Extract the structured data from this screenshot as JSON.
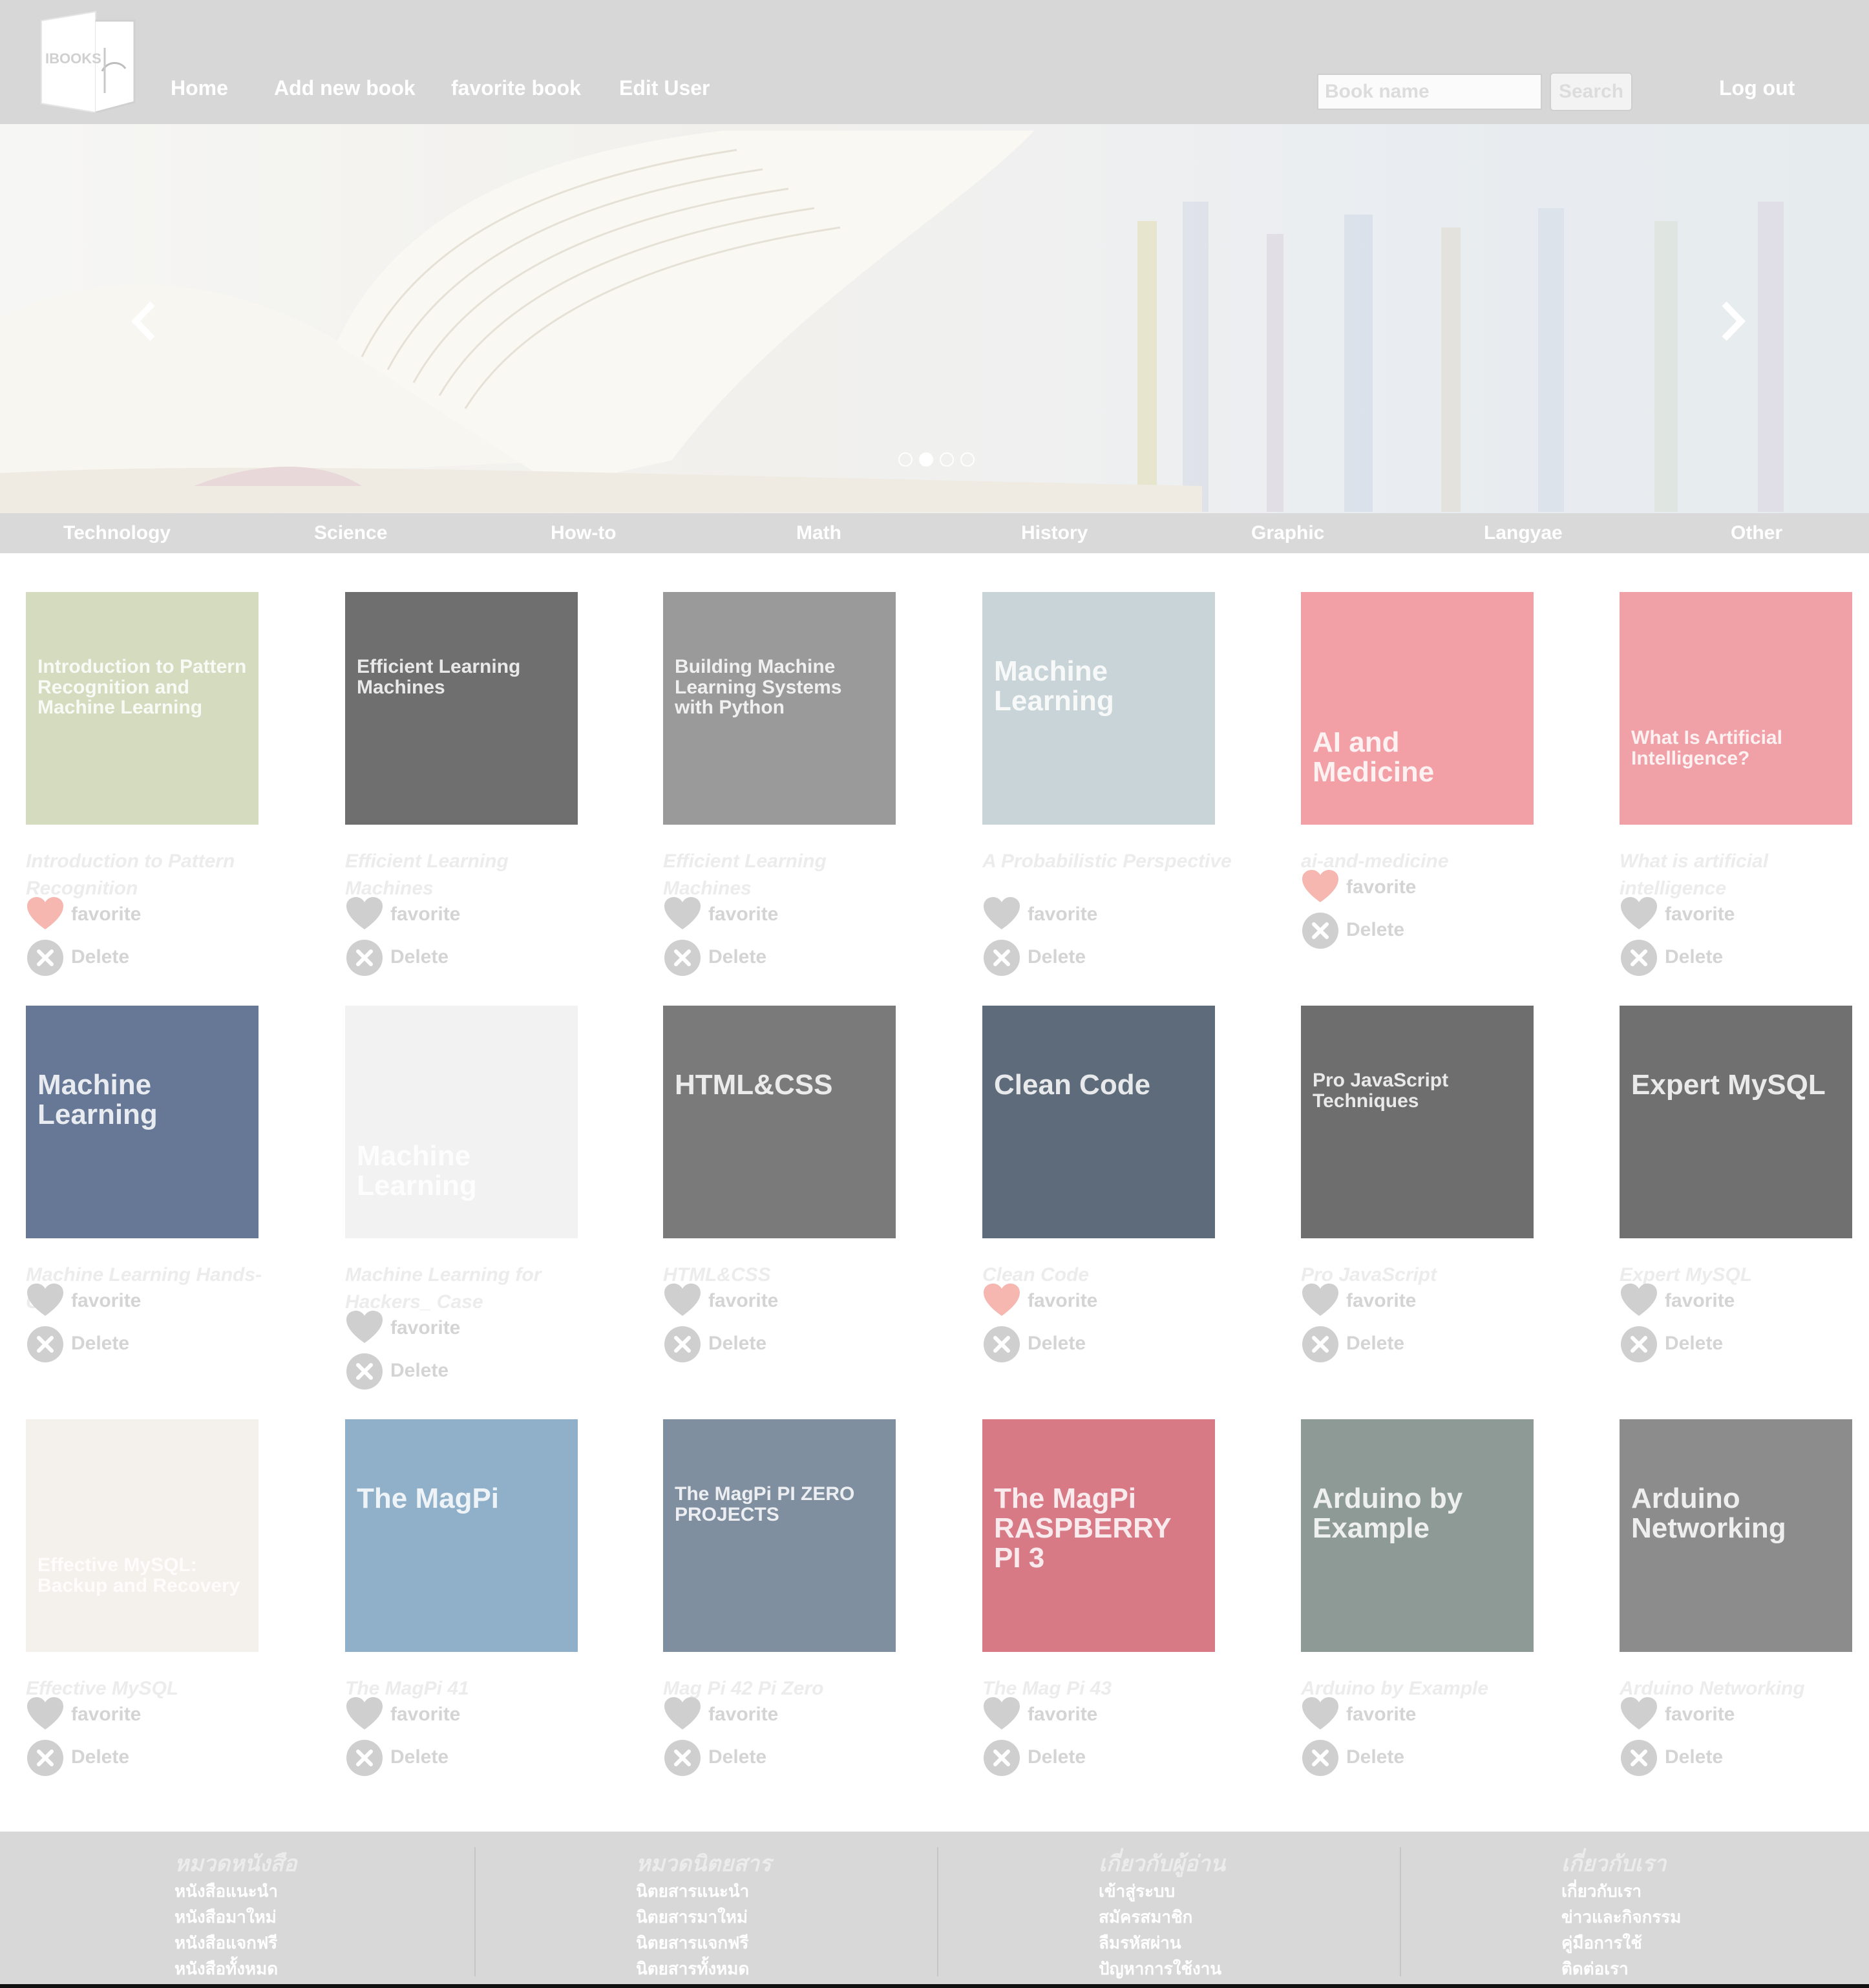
{
  "app": {
    "logo_text": "IBOOKS"
  },
  "nav": {
    "home": "Home",
    "add_new_book": "Add new book",
    "favorite_book": "favorite book",
    "edit_user": "Edit User",
    "logout": "Log out"
  },
  "search": {
    "placeholder": "Book name",
    "button": "Search"
  },
  "carousel": {
    "slide_count": 4,
    "active_index": 1
  },
  "categories": [
    "Technology",
    "Science",
    "How-to",
    "Math",
    "History",
    "Graphic",
    "Langyae",
    "Other"
  ],
  "actions": {
    "favorite": "favorite",
    "delete": "Delete"
  },
  "colors": {
    "header_bg": "#d7d7d7",
    "favorite_active": "#f5b7b0",
    "favorite_inactive": "#cfcfcf",
    "delete_icon": "#cfcfcf"
  },
  "books": [
    {
      "title": "Introduction to Pattern Recognition",
      "favorited": true,
      "cover_color": "#d4dbbf",
      "cover_text": "Introduction to Pattern Recognition and Machine Learning"
    },
    {
      "title": "Efficient Learning Machines",
      "favorited": false,
      "cover_color": "#6f6f6f",
      "cover_text": "Efficient Learning Machines"
    },
    {
      "title": "Efficient Learning Machines",
      "favorited": false,
      "cover_color": "#9a9a9a",
      "cover_text": "Building Machine Learning Systems with Python"
    },
    {
      "title": "A Probabilistic Perspective",
      "favorited": false,
      "cover_color": "#c8d4d8",
      "cover_text": "Machine Learning"
    },
    {
      "title": "ai-and-medicine",
      "favorited": true,
      "cover_color": "#f2a0a6",
      "cover_text": "AI and Medicine"
    },
    {
      "title": "What is artificial intelligence",
      "favorited": false,
      "cover_color": "#f0a1a8",
      "cover_text": "What Is Artificial Intelligence?"
    },
    {
      "title": "Machine Learning Hands-On",
      "favorited": false,
      "cover_color": "#667896",
      "cover_text": "Machine Learning"
    },
    {
      "title": "Machine Learning for Hackers_ Case",
      "favorited": false,
      "cover_color": "#f2f2f2",
      "cover_text": "Machine Learning"
    },
    {
      "title": "HTML&CSS",
      "favorited": false,
      "cover_color": "#7a7a7a",
      "cover_text": "HTML&CSS"
    },
    {
      "title": "Clean Code",
      "favorited": true,
      "cover_color": "#5d6b7a",
      "cover_text": "Clean Code"
    },
    {
      "title": "Pro JavaScript",
      "favorited": false,
      "cover_color": "#6e6e6e",
      "cover_text": "Pro JavaScript Techniques"
    },
    {
      "title": "Expert MySQL",
      "favorited": false,
      "cover_color": "#707070",
      "cover_text": "Expert MySQL"
    },
    {
      "title": "Effective MySQL",
      "favorited": false,
      "cover_color": "#f4f0ec",
      "cover_text": "Effective MySQL: Backup and Recovery"
    },
    {
      "title": "The MagPi 41",
      "favorited": false,
      "cover_color": "#8fb0c8",
      "cover_text": "The MagPi"
    },
    {
      "title": "Mag Pi 42 Pi Zero",
      "favorited": false,
      "cover_color": "#7f8fa0",
      "cover_text": "The MagPi PI ZERO PROJECTS"
    },
    {
      "title": "The Mag Pi 43",
      "favorited": false,
      "cover_color": "#d87a86",
      "cover_text": "The MagPi RASPBERRY PI 3"
    },
    {
      "title": "Arduino by Example",
      "favorited": false,
      "cover_color": "#8e9a96",
      "cover_text": "Arduino by Example"
    },
    {
      "title": "Arduino Networking",
      "favorited": false,
      "cover_color": "#8c8c8c",
      "cover_text": "Arduino Networking"
    }
  ],
  "footer": [
    {
      "heading": "หมวดหนังสือ",
      "links": [
        "หนังสือแนะนำ",
        "หนังสือมาใหม่",
        "หนังสือแจกฟรี",
        "หนังสือทั้งหมด"
      ]
    },
    {
      "heading": "หมวดนิตยสาร",
      "links": [
        "นิตยสารแนะนำ",
        "นิตยสารมาใหม่",
        "นิตยสารแจกฟรี",
        "นิตยสารทั้งหมด"
      ]
    },
    {
      "heading": "เกี่ยวกับผู้อ่าน",
      "links": [
        "เข้าสู่ระบบ",
        "สมัครสมาชิก",
        "ลืมรหัสผ่าน",
        "ปัญหาการใช้งาน"
      ]
    },
    {
      "heading": "เกี่ยวกับเรา",
      "links": [
        "เกี่ยวกับเรา",
        "ข่าวและกิจกรรม",
        "คู่มือการใช้",
        "ติดต่อเรา"
      ]
    }
  ]
}
